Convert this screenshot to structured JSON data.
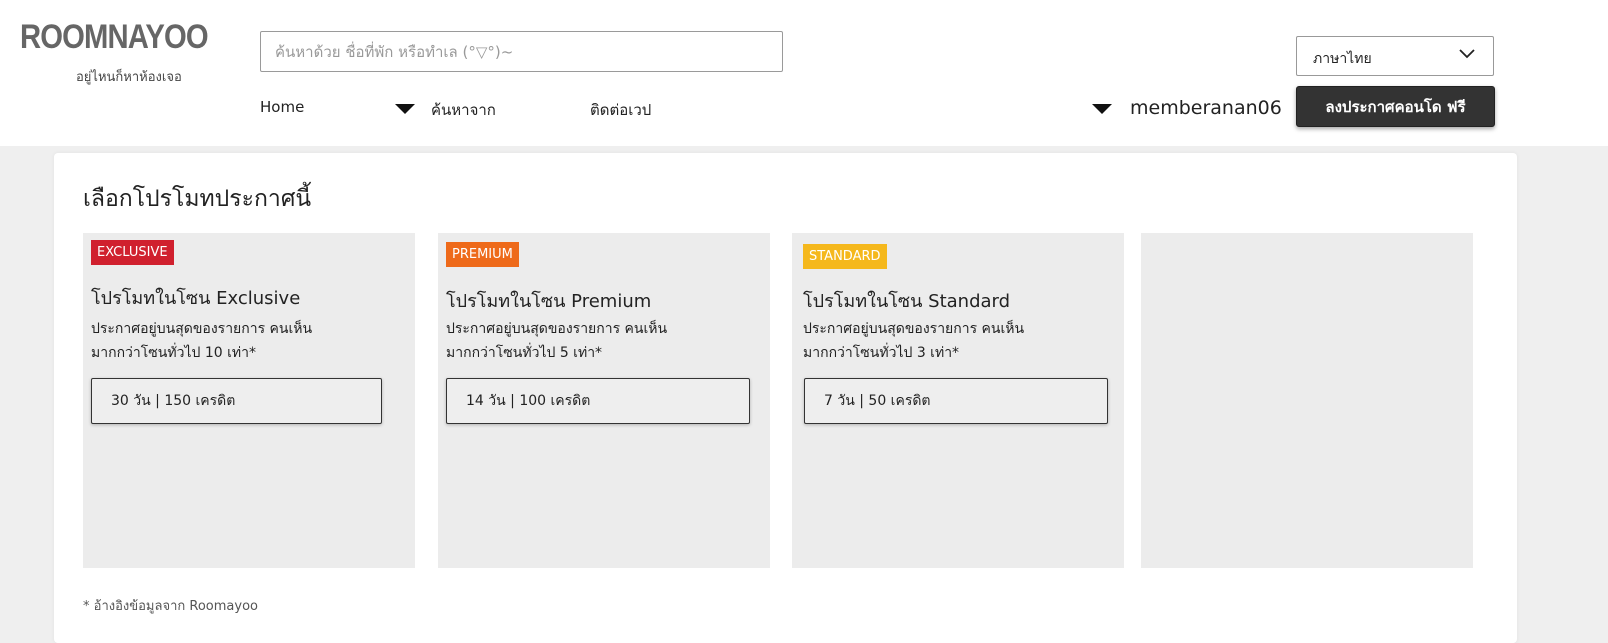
{
  "header": {
    "logo": "ROOMNAYOO",
    "tagline": "อยู่ไหนก็หาห้องเจอ",
    "search_placeholder": "ค้นหาด้วย ชื่อที่พัก หรือทำเล (°▽°)~",
    "nav": {
      "home": "Home",
      "search_from": "ค้นหาจาก",
      "contact": "ติดต่อเวป"
    },
    "language": "ภาษาไทย",
    "username": "memberanan06",
    "post_button": "ลงประกาศคอนโด ฟรี"
  },
  "panel": {
    "title": "เลือกโปรโมทประกาศนี้",
    "cards": [
      {
        "badge": "EXCLUSIVE",
        "badge_color": "#d0202e",
        "title": "โปรโมทในโซน Exclusive",
        "desc_line1": "ประกาศอยู่บนสุดของรายการ คนเห็น",
        "desc_line2": "มากกว่าโซนทั่วไป 10 เท่า*",
        "option": "30 วัน | 150 เครดิต"
      },
      {
        "badge": "PREMIUM",
        "badge_color": "#ee6a1a",
        "title": "โปรโมทในโซน Premium",
        "desc_line1": "ประกาศอยู่บนสุดของรายการ คนเห็น",
        "desc_line2": "มากกว่าโซนทั่วไป 5 เท่า*",
        "option": "14 วัน | 100 เครดิต"
      },
      {
        "badge": "STANDARD",
        "badge_color": "#f5b81c",
        "title": "โปรโมทในโซน Standard",
        "desc_line1": "ประกาศอยู่บนสุดของรายการ คนเห็น",
        "desc_line2": "มากกว่าโซนทั่วไป 3 เท่า*",
        "option": "7 วัน | 50 เครดิต"
      }
    ],
    "footnote": "* อ้างอิงข้อมูลจาก Roomayoo"
  }
}
